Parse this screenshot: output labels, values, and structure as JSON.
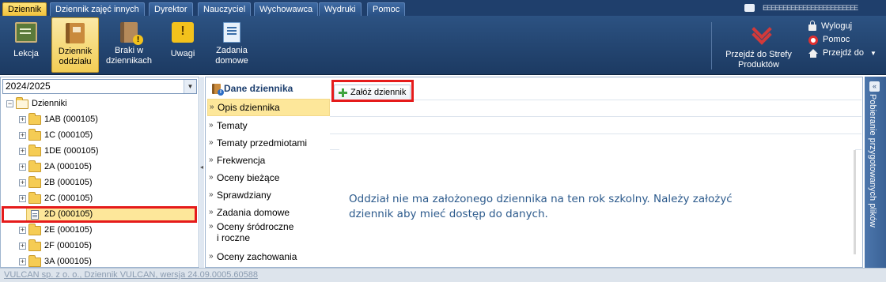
{
  "menu": {
    "tabs": [
      "Dziennik",
      "Dziennik zajęć innych",
      "Dyrektor",
      "Nauczyciel",
      "Wychowawca",
      "Wydruki",
      "Pomoc"
    ],
    "active": "Dziennik",
    "user_name": "EEEEEEEEEEEEEEEEEEEEEEEE"
  },
  "ribbon": {
    "lekcja": "Lekcja",
    "dziennik_oddzialu": "Dziennik\noddziału",
    "braki": "Braki w\ndziennikach",
    "uwagi": "Uwagi",
    "zadania": "Zadania\ndomowe",
    "strefa": "Przejdź do Strefy Produktów",
    "wyloguj": "Wyloguj",
    "pomoc": "Pomoc",
    "przejdz_do": "Przejdź do"
  },
  "year_select": {
    "value": "2024/2025"
  },
  "tree": {
    "root": "Dzienniki",
    "items": [
      "1AB (000105)",
      "1C (000105)",
      "1DE (000105)",
      "2A (000105)",
      "2B (000105)",
      "2C (000105)",
      "2D (000105)",
      "2E (000105)",
      "2F (000105)",
      "3A (000105)"
    ],
    "selected": "2D (000105)"
  },
  "nav": {
    "header": "Dane dziennika",
    "items": [
      "Opis dziennika",
      "Tematy",
      "Tematy przedmiotami",
      "Frekwencja",
      "Oceny bieżące",
      "Sprawdziany",
      "Zadania domowe",
      "Oceny śródroczne\ni roczne",
      "Oceny zachowania"
    ],
    "active": "Opis dziennika"
  },
  "main": {
    "add_button": "Załóż dziennik",
    "message": "Oddział nie ma założonego dziennika na ten rok szkolny. Należy założyć\ndziennik aby mieć dostęp do danych."
  },
  "right_panel": {
    "title": "Pobieranie przygotowanych plików"
  },
  "footer": {
    "text": "VULCAN sp. z o. o., Dziennik VULCAN, wersja 24.09.0005.60588"
  },
  "colors": {
    "highlight_red": "#e51b1b",
    "nav_dark": "#1f3f6c",
    "selected_yellow": "#fde79a",
    "message_blue": "#2c5a8c"
  }
}
